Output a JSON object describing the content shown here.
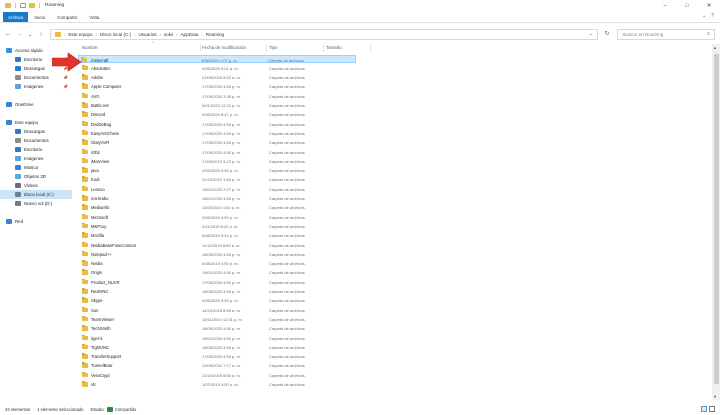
{
  "window": {
    "title": "Roaming",
    "controls": {
      "minimize": "–",
      "maximize": "□",
      "close": "✕"
    }
  },
  "ribbon": {
    "tabs": [
      "Archivo",
      "Inicio",
      "Compartir",
      "Vista"
    ],
    "collapse_glyph": "⌄",
    "help_glyph": "?"
  },
  "nav": {
    "back": "←",
    "forward": "→",
    "recent": "⌄",
    "up": "↑",
    "refresh": "↻",
    "breadcrumbs": [
      "Este equipo",
      "Disco local (C:)",
      "Usuarios",
      "solvi",
      "AppData",
      "Roaming"
    ],
    "crumb_separator": "›",
    "dropdown": "⌄"
  },
  "search": {
    "placeholder": "Buscar en Roaming",
    "icon": "search-icon"
  },
  "sidebar": {
    "items": [
      {
        "label": "Acceso rápido",
        "icon": "star-icon",
        "color": "#3a8fe0",
        "indent": 0,
        "pin": ""
      },
      {
        "label": "Escritorio",
        "icon": "desktop-icon",
        "color": "#2f79c9",
        "indent": 1,
        "pin": "📌"
      },
      {
        "label": "Descargas",
        "icon": "download-icon",
        "color": "#2f79c9",
        "indent": 1,
        "pin": "📌"
      },
      {
        "label": "Documentos",
        "icon": "document-icon",
        "color": "#8d8d8d",
        "indent": 1,
        "pin": "📌"
      },
      {
        "label": "Imágenes",
        "icon": "image-icon",
        "color": "#5fa0d8",
        "indent": 1,
        "pin": "📌"
      },
      {
        "label": "",
        "icon": "",
        "color": "",
        "indent": 0,
        "pin": ""
      },
      {
        "label": "OneDrive",
        "icon": "cloud-icon",
        "color": "#3b7fd4",
        "indent": 0,
        "pin": ""
      },
      {
        "label": "",
        "icon": "",
        "color": "",
        "indent": 0,
        "pin": ""
      },
      {
        "label": "Este equipo",
        "icon": "computer-icon",
        "color": "#3b7fd4",
        "indent": 0,
        "pin": ""
      },
      {
        "label": "Descargas",
        "icon": "download-icon",
        "color": "#2f79c9",
        "indent": 1,
        "pin": ""
      },
      {
        "label": "Documentos",
        "icon": "document-icon",
        "color": "#8d8d8d",
        "indent": 1,
        "pin": ""
      },
      {
        "label": "Escritorio",
        "icon": "desktop-icon",
        "color": "#2f79c9",
        "indent": 1,
        "pin": ""
      },
      {
        "label": "Imágenes",
        "icon": "image-icon",
        "color": "#5fa0d8",
        "indent": 1,
        "pin": ""
      },
      {
        "label": "Música",
        "icon": "music-icon",
        "color": "#3b7fd4",
        "indent": 1,
        "pin": ""
      },
      {
        "label": "Objetos 3D",
        "icon": "cube-icon",
        "color": "#5aa7e0",
        "indent": 1,
        "pin": ""
      },
      {
        "label": "Vídeos",
        "icon": "video-icon",
        "color": "#6b6b8f",
        "indent": 1,
        "pin": ""
      },
      {
        "label": "Disco local (C:)",
        "icon": "drive-icon",
        "color": "#6f7f8f",
        "indent": 1,
        "pin": "",
        "selected": true
      },
      {
        "label": "Nuevo vol (D:)",
        "icon": "drive-icon",
        "color": "#6f7f8f",
        "indent": 1,
        "pin": ""
      },
      {
        "label": "",
        "icon": "",
        "color": "",
        "indent": 0,
        "pin": ""
      },
      {
        "label": "Red",
        "icon": "network-icon",
        "color": "#3b7fd4",
        "indent": 0,
        "pin": ""
      }
    ]
  },
  "columns": {
    "name": "Nombre",
    "date": "Fecha de modificación",
    "type": "Tipo",
    "size": "Tamaño",
    "sort_glyph": "^"
  },
  "files": [
    {
      "name": ".minecraft",
      "date": "3/06/2020 1:07 p. m.",
      "type": "Carpeta de archivos",
      "selected": true
    },
    {
      "name": "Absoluttec",
      "date": "3/06/2020 9:01 a. m.",
      "type": "Carpeta de archivos"
    },
    {
      "name": "Adobe",
      "date": "21/05/2020 8:02 a. m.",
      "type": "Carpeta de archivos"
    },
    {
      "name": "Apple Computer",
      "date": "17/05/2020 4:53 p. m.",
      "type": "Carpeta de archivos"
    },
    {
      "name": "AVG",
      "date": "17/05/2020 3:35 p. m.",
      "type": "Carpeta de archivos"
    },
    {
      "name": "Battle.net",
      "date": "9/01/2020 12:22 p. m.",
      "type": "Carpeta de archivos"
    },
    {
      "name": "Discord",
      "date": "3/06/2020 8:47 p. m.",
      "type": "Carpeta de archivos"
    },
    {
      "name": "DvdDeBug",
      "date": "17/05/2020 4:50 p. m.",
      "type": "Carpeta de archivos"
    },
    {
      "name": "EasyAntiCheat",
      "date": "17/05/2020 4:50 p. m.",
      "type": "Carpeta de archivos"
    },
    {
      "name": "GlaryAVR",
      "date": "17/05/2020 4:50 p. m.",
      "type": "Carpeta de archivos"
    },
    {
      "name": "iObit",
      "date": "17/05/2020 4:50 p. m.",
      "type": "Carpeta de archivos"
    },
    {
      "name": "iManView",
      "date": "17/09/2019 3:22 p. m.",
      "type": "Carpeta de archivos"
    },
    {
      "name": "java",
      "date": "2/04/2020 4:50 p. m.",
      "type": "Carpeta de archivos"
    },
    {
      "name": "Kodi",
      "date": "21/12/2019 1:50 p. m.",
      "type": "Carpeta de archivos"
    },
    {
      "name": "Lenovo",
      "date": "19/01/2020 2:27 p. m.",
      "type": "Carpeta de archivos"
    },
    {
      "name": "ma-leabu",
      "date": "16/01/2020 4:50 p. m.",
      "type": "Carpeta de archivos"
    },
    {
      "name": "MediaInfo",
      "date": "11/05/2020 4:50 p. m.",
      "type": "Carpeta de archivos"
    },
    {
      "name": "Microsoft",
      "date": "3/06/2020 4:50 p. m.",
      "type": "Carpeta de archivos"
    },
    {
      "name": "MKPcvy",
      "date": "2/11/2019 8:22 a. m.",
      "type": "Carpeta de archivos"
    },
    {
      "name": "Mozilla",
      "date": "6/08/2019 5:24 p. m.",
      "type": "Carpeta de archivos"
    },
    {
      "name": "NvidiaBaseFuseContext",
      "date": "11/12/2019 8:50 a. m.",
      "type": "Carpeta de archivos"
    },
    {
      "name": "Notepad++",
      "date": "18/05/2020 4:50 p. m.",
      "type": "Carpeta de archivos"
    },
    {
      "name": "Nvidia",
      "date": "6/08/2019 4:50 p. m.",
      "type": "Carpeta de archivos"
    },
    {
      "name": "Origin",
      "date": "19/01/2020 4:50 p. m.",
      "type": "Carpeta de archivos"
    },
    {
      "name": "Product_NUVR",
      "date": "17/05/2020 4:50 p. m.",
      "type": "Carpeta de archivos"
    },
    {
      "name": "RealVNC",
      "date": "18/05/2020 4:50 p. m.",
      "type": "Carpeta de archivos"
    },
    {
      "name": "Skype",
      "date": "3/06/2020 4:50 p. m.",
      "type": "Carpeta de archivos"
    },
    {
      "name": "Sun",
      "date": "14/12/2019 8:50 a. m.",
      "type": "Carpeta de archivos"
    },
    {
      "name": "TeamViewer",
      "date": "10/11/2019 12:31 p. m.",
      "type": "Carpeta de archivos"
    },
    {
      "name": "TechSmith",
      "date": "18/05/2020 4:50 p. m.",
      "type": "Carpeta de archivos"
    },
    {
      "name": "tiger-k",
      "date": "15/01/2020 4:50 p. m.",
      "type": "Carpeta de archivos"
    },
    {
      "name": "TightVNC",
      "date": "18/05/2020 4:50 p. m.",
      "type": "Carpeta de archivos"
    },
    {
      "name": "TransferSupport",
      "date": "17/05/2020 4:50 p. m.",
      "type": "Carpeta de archivos"
    },
    {
      "name": "TunnelBear",
      "date": "12/05/2020 7:17 a. m.",
      "type": "Carpeta de archivos"
    },
    {
      "name": "VeraCrypt",
      "date": "22/10/2019 8:50 a. m.",
      "type": "Carpeta de archivos"
    },
    {
      "name": "vlc",
      "date": "1/07/2019 4:50 p. m.",
      "type": "Carpeta de archivos"
    }
  ],
  "status": {
    "count": "42 elementos",
    "selection": "1 elemento seleccionado",
    "state": "Estado:",
    "share": "Compartido"
  },
  "annotation": {
    "color": "#e0352b"
  }
}
